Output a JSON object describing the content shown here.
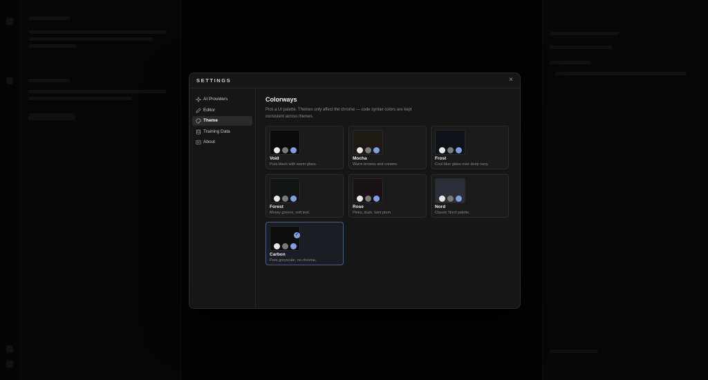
{
  "settings": {
    "title": "SETTINGS",
    "close_icon": "×",
    "nav": [
      {
        "label": "AI Providers",
        "icon": "sparkle-icon"
      },
      {
        "label": "Editor",
        "icon": "pen-icon"
      },
      {
        "label": "Theme",
        "icon": "palette-icon"
      },
      {
        "label": "Training Data",
        "icon": "database-icon"
      },
      {
        "label": "About",
        "icon": "info-icon"
      }
    ]
  },
  "theme": {
    "heading": "Colorways",
    "description": "Pick a UI palette. Themes only affect the chrome — code syntax colors are kept consistent across themes.",
    "check_icon": "✓",
    "palettes": [
      {
        "name": "Void",
        "description": "Pure black with warm glass.",
        "swatch": "#0b0b0c",
        "selected": false
      },
      {
        "name": "Mocha",
        "description": "Warm browns and creams.",
        "swatch": "#1f1914",
        "selected": false
      },
      {
        "name": "Frost",
        "description": "Cool blue glass over deep navy.",
        "swatch": "#0e121b",
        "selected": false
      },
      {
        "name": "Forest",
        "description": "Mossy greens, soft teal.",
        "swatch": "#111612",
        "selected": false
      },
      {
        "name": "Rose",
        "description": "Pinks, dusk, faint plum.",
        "swatch": "#1a1216",
        "selected": false
      },
      {
        "name": "Nord",
        "description": "Classic Nord palette.",
        "swatch": "#2a2f3a",
        "selected": false
      },
      {
        "name": "Carbon",
        "description": "Pure greyscale, no chroma.",
        "swatch": "#0e0e0e",
        "selected": true
      }
    ],
    "accent": "#7f9fe0"
  }
}
